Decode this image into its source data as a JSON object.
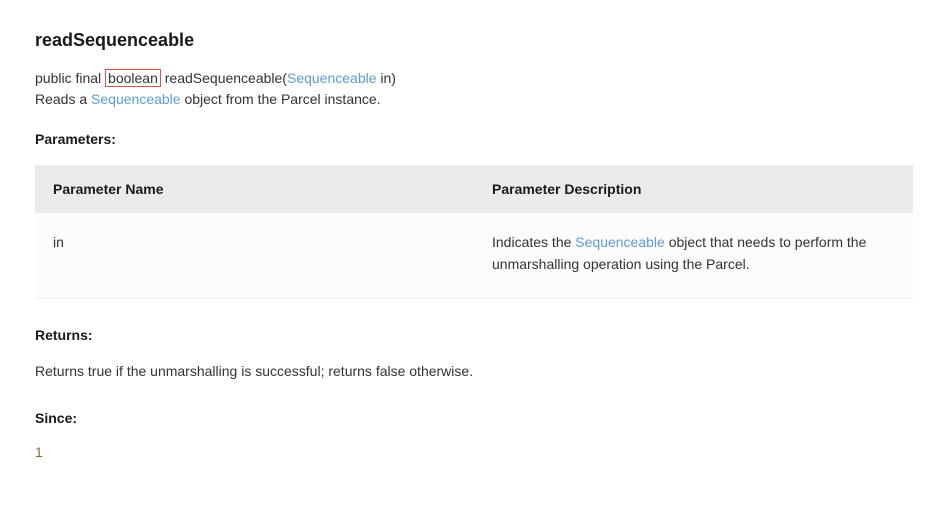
{
  "method": {
    "title": "readSequenceable",
    "signature": {
      "prefix": "public final ",
      "highlighted": "boolean",
      "mid": " readSequenceable(",
      "param_type_link": "Sequenceable",
      "param_name": " in)",
      "suffix": ""
    },
    "description": {
      "prefix": "Reads a ",
      "link": "Sequenceable",
      "suffix": " object from the Parcel instance."
    }
  },
  "parameters": {
    "heading": "Parameters:",
    "columns": {
      "name": "Parameter Name",
      "desc": "Parameter Description"
    },
    "rows": [
      {
        "name": "in",
        "desc_prefix": "Indicates the ",
        "desc_link": "Sequenceable",
        "desc_suffix": " object that needs to perform the unmarshalling operation using the Parcel."
      }
    ]
  },
  "returns": {
    "heading": "Returns:",
    "text": "Returns true if the unmarshalling is successful; returns false otherwise."
  },
  "since": {
    "heading": "Since:",
    "value": "1"
  }
}
